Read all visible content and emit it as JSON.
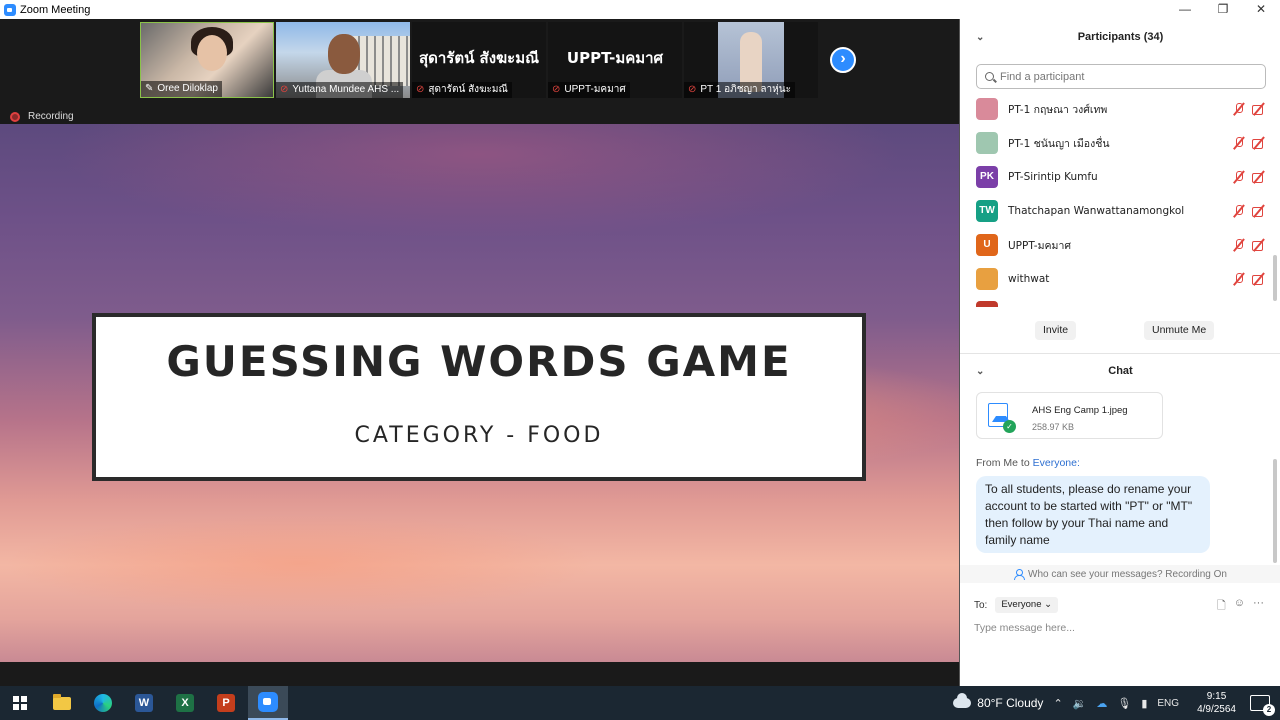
{
  "window": {
    "title": "Zoom Meeting",
    "controls": [
      "—",
      "❐",
      "✕"
    ]
  },
  "thumbnails": [
    {
      "label": "Oree Diloklap",
      "pinned": true
    },
    {
      "label": "Yuttana Mundee AHS ..."
    },
    {
      "label": "สุดารัตน์ สังฆะมณี",
      "name_display": "สุดารัตน์ สังฆะมณี"
    },
    {
      "label": "UPPT-มคมาศ",
      "name_display": "UPPT-มคมาศ"
    },
    {
      "label": "PT 1 อภิชญา ลาหุ่นะ"
    }
  ],
  "next_arrow": "›",
  "recording_label": "Recording",
  "slide": {
    "title": "GUESSING WORDS GAME",
    "subtitle": "CATEGORY - FOOD"
  },
  "participants": {
    "header": "Participants (34)",
    "search_placeholder": "Find a participant",
    "list": [
      {
        "name": "PT-1 กฤษณา วงศ์เทพ",
        "initials": "",
        "color": "#d98a9a"
      },
      {
        "name": "PT-1 ชนันญา เมืองชื่น",
        "initials": "",
        "color": "#9fc7b0"
      },
      {
        "name": "PT-Sirintip Kumfu",
        "initials": "PK",
        "color": "#7b3fa8"
      },
      {
        "name": "Thatchapan Wanwattanamongkol",
        "initials": "TW",
        "color": "#16a085"
      },
      {
        "name": "UPPT-มคมาศ",
        "initials": "U",
        "color": "#e0661a"
      },
      {
        "name": "withwat",
        "initials": "",
        "color": "#e8a040"
      }
    ],
    "invite_label": "Invite",
    "unmute_label": "Unmute Me"
  },
  "chat": {
    "header": "Chat",
    "file": {
      "name": "AHS Eng Camp 1.jpeg",
      "size": "258.97 KB"
    },
    "from_prefix": "From Me to",
    "from_to": "Everyone:",
    "message": "To all students, please do rename your account to be started with \"PT\" or \"MT\" then follow by your Thai name and family name",
    "who_can_see": "Who can see your messages? Recording On",
    "to_label": "To:",
    "to_value": "Everyone ⌄",
    "input_placeholder": "Type message here...",
    "tools": [
      "🗋",
      "☺",
      "···"
    ]
  },
  "taskbar": {
    "weather": "80°F  Cloudy",
    "lang": "ENG",
    "time": "9:15",
    "date": "4/9/2564",
    "notifications": "2",
    "apps": [
      "W",
      "X",
      "P"
    ]
  }
}
